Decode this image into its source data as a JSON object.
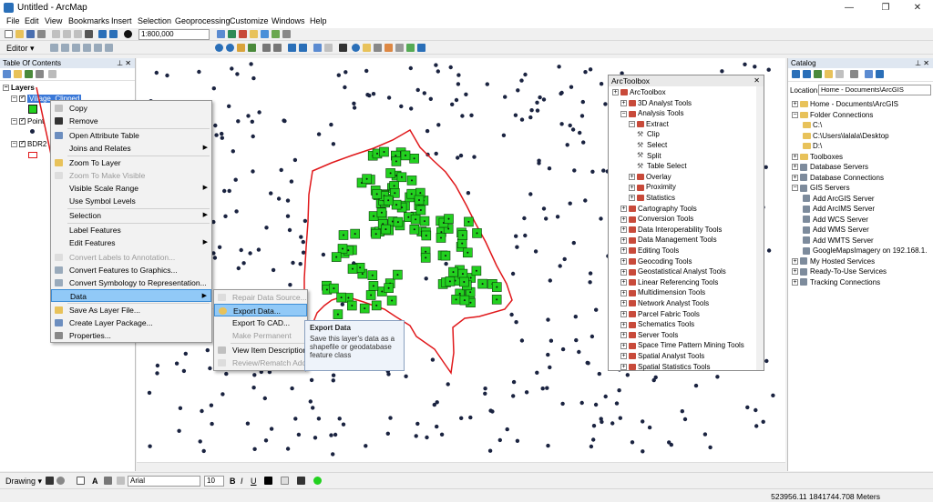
{
  "window": {
    "title": "Untitled - ArcMap",
    "minimize": "—",
    "maximize": "❐",
    "close": "✕"
  },
  "menu": [
    "File",
    "Edit",
    "View",
    "Bookmarks",
    "Insert",
    "Selection",
    "Geoprocessing",
    "Customize",
    "Windows",
    "Help"
  ],
  "toolbar": {
    "scale": "1:800,000",
    "editor_label": "Editor ▾"
  },
  "toc": {
    "title": "Table Of Contents",
    "pin": "⊥ ✕",
    "root": "Layers",
    "layers": [
      "Village_Clipped",
      "Point",
      "BDR2"
    ]
  },
  "context_menu": [
    {
      "label": "Copy",
      "disabled": false
    },
    {
      "label": "Remove",
      "disabled": false
    },
    {
      "label": "Open Attribute Table",
      "disabled": false
    },
    {
      "label": "Joins and Relates",
      "disabled": false,
      "submenu": true
    },
    {
      "label": "Zoom To Layer",
      "disabled": false
    },
    {
      "label": "Zoom To Make Visible",
      "disabled": true
    },
    {
      "label": "Visible Scale Range",
      "disabled": false,
      "submenu": true
    },
    {
      "label": "Use Symbol Levels",
      "disabled": false
    },
    {
      "label": "Selection",
      "disabled": false,
      "submenu": true
    },
    {
      "label": "Label Features",
      "disabled": false
    },
    {
      "label": "Edit Features",
      "disabled": false,
      "submenu": true
    },
    {
      "label": "Convert Labels to Annotation...",
      "disabled": true
    },
    {
      "label": "Convert Features to Graphics...",
      "disabled": false
    },
    {
      "label": "Convert Symbology to Representation...",
      "disabled": false
    },
    {
      "label": "Data",
      "disabled": false,
      "submenu": true,
      "highlighted": true
    },
    {
      "label": "Save As Layer File...",
      "disabled": false
    },
    {
      "label": "Create Layer Package...",
      "disabled": false
    },
    {
      "label": "Properties...",
      "disabled": false
    }
  ],
  "data_submenu": [
    {
      "label": "Repair Data Source...",
      "disabled": true
    },
    {
      "label": "Export Data...",
      "disabled": false,
      "highlighted": true
    },
    {
      "label": "Export To CAD...",
      "disabled": false
    },
    {
      "label": "Make Permanent",
      "disabled": true
    },
    {
      "label": "View Item Description...",
      "disabled": false
    },
    {
      "label": "Review/Rematch Address",
      "disabled": true
    }
  ],
  "tooltip": {
    "title": "Export Data",
    "body": "Save this layer's data as a shapefile or geodatabase feature class"
  },
  "arctoolbox": {
    "title": "ArcToolbox",
    "rows": [
      {
        "label": "ArcToolbox",
        "level": 0,
        "kind": "root"
      },
      {
        "label": "3D Analyst Tools",
        "level": 1,
        "kind": "toolbox"
      },
      {
        "label": "Analysis Tools",
        "level": 1,
        "kind": "toolbox",
        "expanded": true
      },
      {
        "label": "Extract",
        "level": 2,
        "kind": "toolset",
        "expanded": true
      },
      {
        "label": "Clip",
        "level": 3,
        "kind": "tool"
      },
      {
        "label": "Select",
        "level": 3,
        "kind": "tool"
      },
      {
        "label": "Split",
        "level": 3,
        "kind": "tool"
      },
      {
        "label": "Table Select",
        "level": 3,
        "kind": "tool"
      },
      {
        "label": "Overlay",
        "level": 2,
        "kind": "toolset"
      },
      {
        "label": "Proximity",
        "level": 2,
        "kind": "toolset"
      },
      {
        "label": "Statistics",
        "level": 2,
        "kind": "toolset"
      },
      {
        "label": "Cartography Tools",
        "level": 1,
        "kind": "toolbox"
      },
      {
        "label": "Conversion Tools",
        "level": 1,
        "kind": "toolbox"
      },
      {
        "label": "Data Interoperability Tools",
        "level": 1,
        "kind": "toolbox"
      },
      {
        "label": "Data Management Tools",
        "level": 1,
        "kind": "toolbox"
      },
      {
        "label": "Editing Tools",
        "level": 1,
        "kind": "toolbox"
      },
      {
        "label": "Geocoding Tools",
        "level": 1,
        "kind": "toolbox"
      },
      {
        "label": "Geostatistical Analyst Tools",
        "level": 1,
        "kind": "toolbox"
      },
      {
        "label": "Linear Referencing Tools",
        "level": 1,
        "kind": "toolbox"
      },
      {
        "label": "Multidimension Tools",
        "level": 1,
        "kind": "toolbox"
      },
      {
        "label": "Network Analyst Tools",
        "level": 1,
        "kind": "toolbox"
      },
      {
        "label": "Parcel Fabric Tools",
        "level": 1,
        "kind": "toolbox"
      },
      {
        "label": "Schematics Tools",
        "level": 1,
        "kind": "toolbox"
      },
      {
        "label": "Server Tools",
        "level": 1,
        "kind": "toolbox"
      },
      {
        "label": "Space Time Pattern Mining Tools",
        "level": 1,
        "kind": "toolbox"
      },
      {
        "label": "Spatial Analyst Tools",
        "level": 1,
        "kind": "toolbox"
      },
      {
        "label": "Spatial Statistics Tools",
        "level": 1,
        "kind": "toolbox"
      }
    ]
  },
  "catalog": {
    "title": "Catalog",
    "location_label": "Location:",
    "location_value": "Home - Documents\\ArcGIS",
    "rows": [
      {
        "label": "Home - Documents\\ArcGIS",
        "level": 0,
        "kind": "folder"
      },
      {
        "label": "Folder Connections",
        "level": 0,
        "kind": "folder",
        "expanded": true
      },
      {
        "label": "C:\\",
        "level": 1,
        "kind": "folder"
      },
      {
        "label": "C:\\Users\\lalala\\Desktop",
        "level": 1,
        "kind": "folder"
      },
      {
        "label": "D:\\",
        "level": 1,
        "kind": "folder"
      },
      {
        "label": "Toolboxes",
        "level": 0,
        "kind": "folder"
      },
      {
        "label": "Database Servers",
        "level": 0,
        "kind": "server"
      },
      {
        "label": "Database Connections",
        "level": 0,
        "kind": "server"
      },
      {
        "label": "GIS Servers",
        "level": 0,
        "kind": "server",
        "expanded": true
      },
      {
        "label": "Add ArcGIS Server",
        "level": 1,
        "kind": "server"
      },
      {
        "label": "Add ArcIMS Server",
        "level": 1,
        "kind": "server"
      },
      {
        "label": "Add WCS Server",
        "level": 1,
        "kind": "server"
      },
      {
        "label": "Add WMS Server",
        "level": 1,
        "kind": "server"
      },
      {
        "label": "Add WMTS Server",
        "level": 1,
        "kind": "server"
      },
      {
        "label": "GoogleMapsImagery on 192.168.1.",
        "level": 1,
        "kind": "server"
      },
      {
        "label": "My Hosted Services",
        "level": 0,
        "kind": "server"
      },
      {
        "label": "Ready-To-Use Services",
        "level": 0,
        "kind": "server"
      },
      {
        "label": "Tracking Connections",
        "level": 0,
        "kind": "server"
      }
    ]
  },
  "drawing": {
    "label": "Drawing ▾",
    "font": "Arial",
    "size": "10",
    "bold": "B",
    "italic": "I",
    "underline": "U",
    "text_tool": "A"
  },
  "status": {
    "coords": "523956.11  1841744.708 Meters"
  },
  "colors": {
    "selection_green": "#22d11f",
    "boundary_red": "#e0181b",
    "point_navy": "#1a2340",
    "highlight": "#91c9f7"
  }
}
